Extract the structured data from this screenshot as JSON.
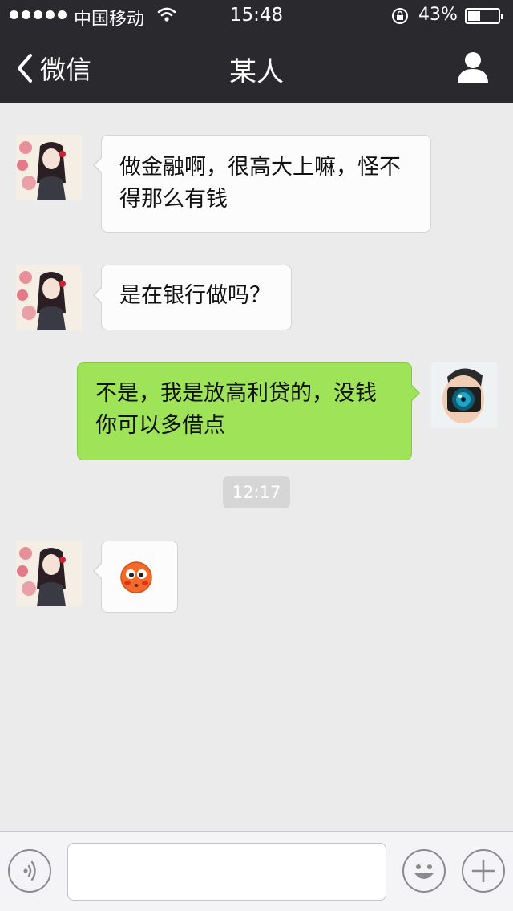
{
  "status_bar": {
    "carrier": "中国移动",
    "time": "15:48",
    "battery_percent": "43%",
    "battery_level": 0.43
  },
  "nav": {
    "back_label": "微信",
    "title": "某人"
  },
  "messages": [
    {
      "side": "left",
      "text_lines": [
        "做金融啊，很高大上嘛，怪不",
        "得那么有钱"
      ]
    },
    {
      "side": "left",
      "text_lines": [
        "是在银行做吗？"
      ]
    },
    {
      "side": "right",
      "text_lines": [
        "不是，我是放高利贷的，没钱",
        "你可以多借点"
      ]
    },
    {
      "side": "left",
      "emoji": "blushing-face"
    }
  ],
  "timestamp": "12:17",
  "input_bar": {
    "voice_icon": "voice-icon",
    "emoji_icon": "smiley-icon",
    "plus_icon": "plus-icon"
  },
  "colors": {
    "outgoing_bubble": "#9ee358",
    "incoming_bubble": "#fcfcfc",
    "topbar": "#2a2a2e",
    "background": "#ebebeb"
  }
}
